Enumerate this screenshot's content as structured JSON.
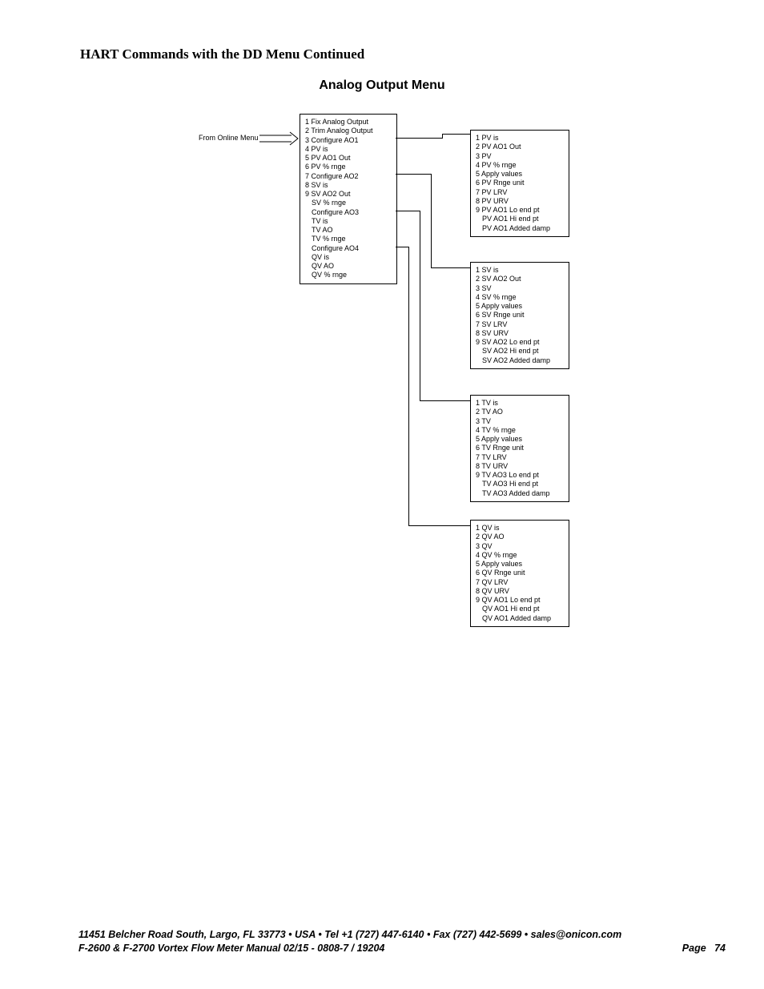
{
  "header": {
    "section_title": "HART Commands with the DD Menu Continued",
    "diagram_title": "Analog Output Menu"
  },
  "diagram": {
    "from_label": "From Online Menu",
    "main_box": {
      "lines": [
        "1 Fix Analog Output",
        "2 Trim Analog Output",
        "3 Configure AO1",
        "4 PV is",
        "5 PV AO1 Out",
        "6 PV % rnge",
        "7 Configure AO2",
        "8 SV is",
        "9 SV AO2 Out",
        "  SV % rnge",
        "  Configure AO3",
        "  TV is",
        "  TV AO",
        "  TV % rnge",
        "  Configure AO4",
        "  QV is",
        "  QV AO",
        "  QV % rnge"
      ]
    },
    "box_ao1": [
      "1 PV is",
      "2 PV AO1 Out",
      "3 PV",
      "4 PV % rnge",
      "5 Apply values",
      "6 PV Rnge unit",
      "7 PV LRV",
      "8 PV URV",
      "9 PV AO1 Lo end pt",
      "   PV AO1 Hi end pt",
      "   PV AO1 Added damp"
    ],
    "box_ao2": [
      "1 SV is",
      "2 SV AO2 Out",
      "3 SV",
      "4 SV % rnge",
      "5 Apply values",
      "6 SV Rnge unit",
      "7 SV LRV",
      "8 SV URV",
      "9 SV AO2 Lo end pt",
      "   SV AO2 Hi end pt",
      "   SV AO2 Added damp"
    ],
    "box_ao3": [
      "1 TV is",
      "2 TV AO",
      "3 TV",
      "4 TV % rnge",
      "5 Apply values",
      "6 TV Rnge unit",
      "7 TV LRV",
      "8 TV URV",
      "9 TV AO3 Lo end pt",
      "   TV AO3 Hi end pt",
      "   TV AO3 Added damp"
    ],
    "box_ao4": [
      "1 QV is",
      "2 QV AO",
      "3 QV",
      "4 QV % rnge",
      "5 Apply values",
      "6 QV Rnge unit",
      "7 QV LRV",
      "8 QV URV",
      "9 QV AO1 Lo end pt",
      "   QV AO1 Hi end pt",
      "   QV AO1 Added damp"
    ]
  },
  "footer": {
    "line1": "11451 Belcher Road South, Largo, FL 33773 • USA • Tel +1 (727) 447-6140 • Fax (727) 442-5699 • sales@onicon.com",
    "line2_left": "F-2600 & F-2700 Vortex Flow Meter Manual 02/15 - 0808-7 / 19204",
    "page_label": "Page   74"
  }
}
